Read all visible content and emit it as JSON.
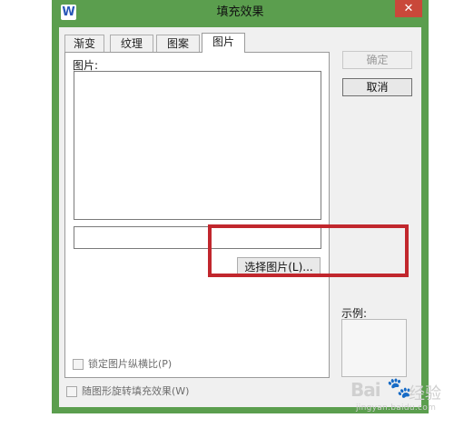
{
  "window": {
    "title": "填充效果",
    "app_icon_letter": "W",
    "close_glyph": "✕"
  },
  "tabs": [
    {
      "label": "渐变",
      "active": false
    },
    {
      "label": "纹理",
      "active": false
    },
    {
      "label": "图案",
      "active": false
    },
    {
      "label": "图片",
      "active": true
    }
  ],
  "picture_panel": {
    "picture_label": "图片:",
    "path_value": "",
    "select_button_label": "选择图片(L)...",
    "lock_aspect_label": "锁定图片纵横比(P)"
  },
  "rotate_with_shape_label": "随图形旋转填充效果(W)",
  "buttons": {
    "ok_label": "确定",
    "cancel_label": "取消"
  },
  "sample": {
    "label": "示例:"
  },
  "watermark": {
    "logo_text": "Bai",
    "paw_glyph": "🐾",
    "text": "经验",
    "url": "jingyan.baidu.com"
  }
}
